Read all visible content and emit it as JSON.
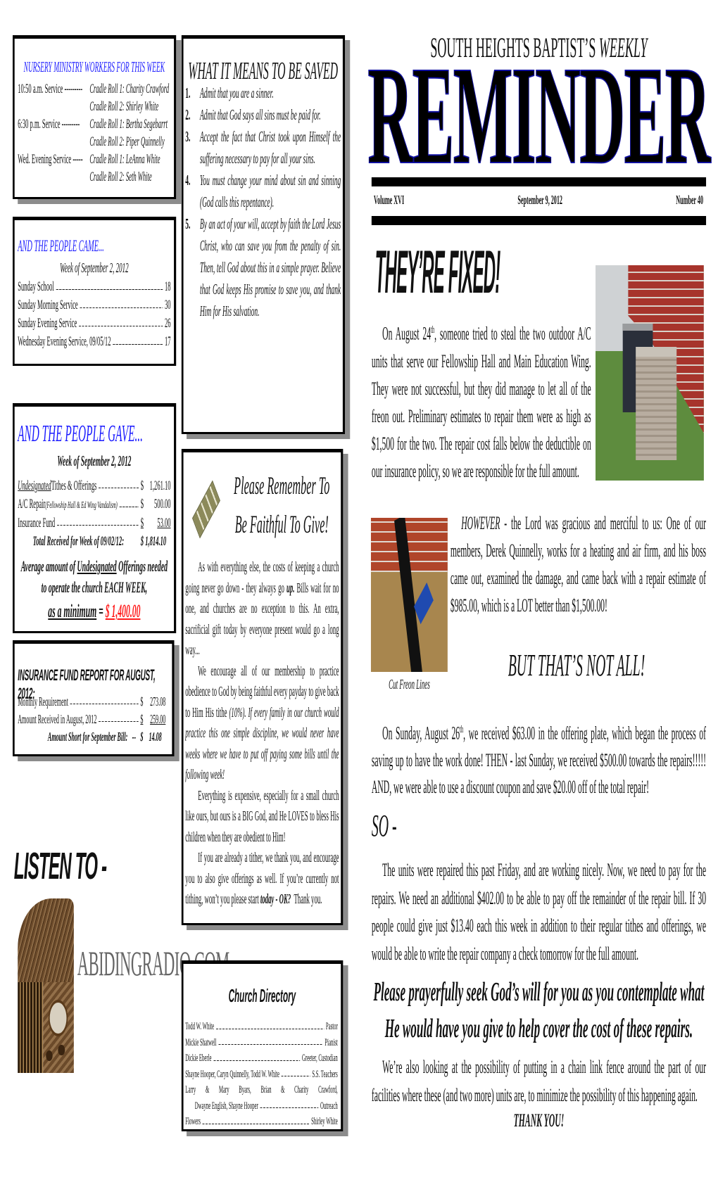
{
  "nursery": {
    "title": "NURSERY MINISTRY WORKERS FOR THIS WEEK",
    "rows": [
      {
        "service": "10:50 a.m. Service ---------",
        "workers": [
          "Cradle Roll 1: Charity Crawford",
          "Cradle Roll 2: Shirley White"
        ]
      },
      {
        "service": "6:30 p.m. Service ---------",
        "workers": [
          "Cradle Roll 1: Bertha Segebarrt",
          "Cradle Roll 2: Piper Quinnelly"
        ]
      },
      {
        "service": "Wed. Evening Service -----",
        "workers": [
          "Cradle Roll 1: LeAnna White",
          "Cradle Roll 2: Seth White"
        ]
      }
    ]
  },
  "attendance": {
    "title": "AND THE PEOPLE CAME...",
    "week": "Week of September 2, 2012",
    "rows": [
      {
        "label": "Sunday School",
        "count": "18"
      },
      {
        "label": "Sunday Morning Service",
        "count": "30"
      },
      {
        "label": "Sunday Evening Service",
        "count": "26"
      },
      {
        "label": "Wednesday Evening Service, 09/05/12",
        "count": "17"
      }
    ]
  },
  "giving": {
    "title": "AND THE PEOPLE GAVE...",
    "week": "Week of September 2, 2012",
    "rows": [
      {
        "label_em": "Undesignated",
        "label": " Tithes & Offerings",
        "note": "",
        "currency": "$",
        "amount": "1,261.10"
      },
      {
        "label_em": "",
        "label": "A/C Repair ",
        "note": "(Fellowship Hall & Ed Wing Vandalism)",
        "currency": "$",
        "amount": "500.00"
      },
      {
        "label_em": "",
        "label": "Insurance Fund",
        "note": "",
        "currency": "$",
        "amount": "53.00"
      }
    ],
    "total_label": "Total Received for Week of 09/02/12:",
    "total_amount": "$ 1,814.10",
    "avg_line1_a": "Average amount of ",
    "avg_line1_u": "Undesignated",
    "avg_line1_b": " Offerings needed",
    "avg_line2": "to operate the church EACH WEEK,",
    "avg_min_label": "as a minimum",
    "avg_equals": " = ",
    "avg_min_amount": "$ 1,400.00"
  },
  "insurance": {
    "title": "INSURANCE FUND REPORT FOR AUGUST, 2012:",
    "rows": [
      {
        "label": "Monthly Requirement",
        "currency": "$",
        "amount": "273.08"
      },
      {
        "label": "Amount Received in August, 2012",
        "currency": "$",
        "amount": "259.00"
      }
    ],
    "short_label": "Amount Short for September Bill:",
    "short_prefix": "--",
    "short_amount": "$    14.08"
  },
  "listen": {
    "heading": "LISTEN TO -",
    "site": "ABIDINGRADIO.COM",
    "icon": "vintage-radio-icon"
  },
  "saved": {
    "title": "WHAT IT MEANS TO BE SAVED",
    "items": [
      {
        "num": "1.",
        "text": "Admit that you are a sinner."
      },
      {
        "num": "2.",
        "text": "Admit that God says all sins must be paid for."
      },
      {
        "num": "3.",
        "text": "Accept the fact that Christ took upon Himself the suffering necessary to pay for all your sins."
      },
      {
        "num": "4.",
        "text": "You must change your mind about sin and sinning (God calls this repentance)."
      },
      {
        "num": "5.",
        "text": "By an act of your will, accept by faith the Lord Jesus Christ, who can save you from the penalty of sin. Then, tell God about this in a simple prayer. Believe that God keeps His promise to save you, and thank Him for His salvation."
      }
    ]
  },
  "give": {
    "icon": "money-icon",
    "title_line1": "Please Remember To",
    "title_line2": "Be Faithful To Give!",
    "p1_a": "As with everything else, the costs of keeping a church going never go down - they always go ",
    "p1_em": "up.",
    "p1_b": " Bills wait for no one, and churches are no exception to this. An extra, sacrificial gift today by everyone present would go a long way...",
    "p2_a": "We encourage all of our membership to practice obedience to God by being faithful every payday to give back to Him His tithe ",
    "p2_em": "(10%). If every family in our church would practice this one simple discipline, we would never have weeks where we have to put off paying some bills until the following week!",
    "p3": "Everything is expensive, especially for a small church like ours, but ours is a BIG God, and He LOVES to bless His children when they are obedient to Him!",
    "p4_a": "If you are already a tither, we thank you, and encourage you to also give offerings as well. If you’re currently not tithing, won’t you please start ",
    "p4_em": "today - OK?",
    "p4_b": "  Thank you."
  },
  "directory": {
    "title": "Church Directory",
    "entries": [
      {
        "name": "Todd W. White",
        "role": "Pastor"
      },
      {
        "name": "Mickie Shatwell",
        "role": "Pianist"
      },
      {
        "name": "Dickie Eberle",
        "role": "Greeter, Custodian"
      },
      {
        "name": "Shayne Hooper, Caryn Quinnelly, Todd W. White",
        "role": "S.S. Teachers"
      }
    ],
    "outreach_line1": "Larry & Mary Byars, Brian & Charity Crawford,",
    "outreach_line2": "Dwayne English, Shayne Hooper",
    "outreach_role": "Outreach",
    "flowers_name": "Flowers",
    "flowers_role": "Shirley White"
  },
  "masthead": {
    "kicker": "SOUTH HEIGHTS BAPTIST’S ",
    "kicker_em": "WEEKLY",
    "title": "REMINDER",
    "volume": "Volume XVI",
    "date": "September 9, 2012",
    "number": "Number 40"
  },
  "article": {
    "headline": "THEY’RE FIXED!",
    "p1_a": "On August 24",
    "p1_sup": "th",
    "p1_b": ", someone tried to steal the two outdoor A/C units that serve our Fellowship Hall and Main Education Wing. They were not successful, but they did manage to let all of the freon out. Preliminary estimates to repair them were as high as $1,500 for the two. The repair cost falls below the deductible on our insurance policy, so we are responsible for the full amount.",
    "p2_em": "HOWEVER - ",
    "p2": "the Lord was gracious and merciful to us: One of our members, Derek Quinnelly, works for a heating and air firm, and his boss came out, examined the damage, and came back with a repair estimate of $985.00, which is a LOT better than $1,500.00!",
    "photo_caption": "Cut Freon Lines",
    "subhead": "BUT THAT’S NOT ALL!",
    "p3_a": "On Sunday, August 26",
    "p3_sup": "th",
    "p3_b": ", we received $63.00 in the offering plate, which began the process of saving up to have the work done! THEN - last Sunday, we received $500.00 towards the repairs!!!!! AND, we were able to use a discount coupon and save $20.00 off of the total repair!",
    "so": "SO -",
    "p4": "The units were repaired this past Friday, and are working nicely. Now, we need to pay for the repairs. We need an additional $402.00 to be able to pay off the remainder of the repair bill. If 30 people could give just $13.40 each this week in addition to their regular tithes and offerings, we would be able to write the repair company a check tomorrow for the full amount.",
    "appeal": "Please prayerfully seek God’s will for you as you contemplate what He would have you give to help cover the cost of these repairs.",
    "p5": "We’re also looking at the possibility of putting in a chain link fence around the part of our facilities where these (and two more) units are, to minimize the possibility of this happening again.",
    "thanks": "THANK YOU!"
  },
  "colors": {
    "heading_blue": "#1a1aff",
    "minimum_red": "#ff1a1a",
    "shadow_gray": "#8c8c8c"
  }
}
